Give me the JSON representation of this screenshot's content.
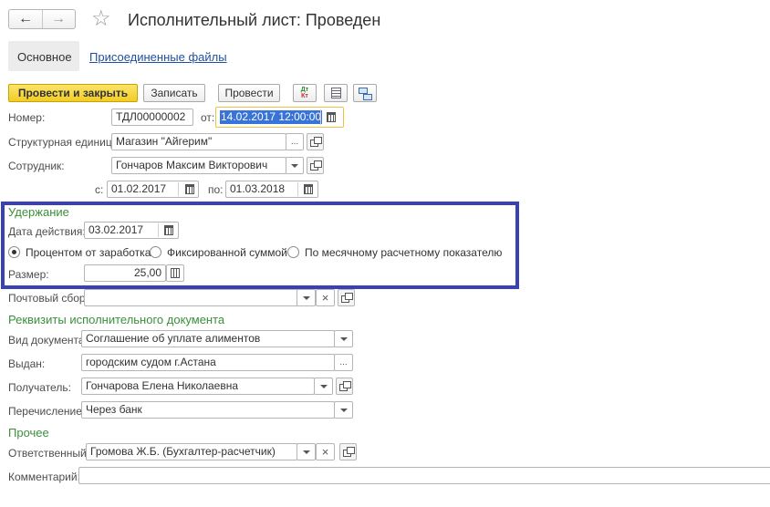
{
  "window": {
    "title": "Исполнительный лист: Проведен",
    "back_glyph": "←",
    "forward_glyph": "→",
    "star_glyph": "☆"
  },
  "tabs": [
    {
      "label": "Основное",
      "active": true
    },
    {
      "label": "Присоединенные файлы",
      "active": false
    }
  ],
  "toolbar": {
    "post_close": "Провести и закрыть",
    "save": "Записать",
    "post": "Провести",
    "dtkt_top": "Дт",
    "dtkt_bottom": "Кт"
  },
  "header": {
    "number_label": "Номер:",
    "number_value": "ТДЛ00000002",
    "from_label": "от:",
    "date_value": "14.02.2017 12:00:00",
    "unit_label": "Структурная единица:",
    "unit_value": "Магазин \"Айгерим\"",
    "employee_label": "Сотрудник:",
    "employee_value": "Гончаров Максим Викторович",
    "period_from_label": "с:",
    "period_from_value": "01.02.2017",
    "period_to_label": "по:",
    "period_to_value": "01.03.2018"
  },
  "withholding": {
    "title": "Удержание",
    "date_label": "Дата действия:",
    "date_value": "03.02.2017",
    "options": [
      {
        "label": "Процентом от заработка",
        "selected": true
      },
      {
        "label": "Фиксированной суммой",
        "selected": false
      },
      {
        "label": "По месячному расчетному показателю",
        "selected": false
      }
    ],
    "amount_label": "Размер:",
    "amount_value": "25,00",
    "highlight_color": "#3a41b5"
  },
  "postal": {
    "label": "Почтовый сбор:",
    "value": ""
  },
  "requisites": {
    "title": "Реквизиты исполнительного документа",
    "doc_type_label": "Вид документа:",
    "doc_type_value": "Соглашение об уплате алиментов",
    "issued_label": "Выдан:",
    "issued_value": "городским судом г.Астана",
    "recipient_label": "Получатель:",
    "recipient_value": "Гончарова Елена Николаевна",
    "transfer_label": "Перечисление:",
    "transfer_value": "Через банк"
  },
  "other": {
    "title": "Прочее",
    "responsible_label": "Ответственный:",
    "responsible_value": "Громова Ж.Б. (Бухгалтер-расчетчик)",
    "comment_label": "Комментарий:",
    "comment_value": ""
  },
  "glyphs": {
    "ellipsis": "...",
    "clear": "×"
  },
  "colors": {
    "accent_yellow": "#f5d531",
    "section_green": "#3b8f3b",
    "link_blue": "#1f4f9e",
    "focus_border": "#f0c040",
    "selection_blue": "#3874d8"
  }
}
